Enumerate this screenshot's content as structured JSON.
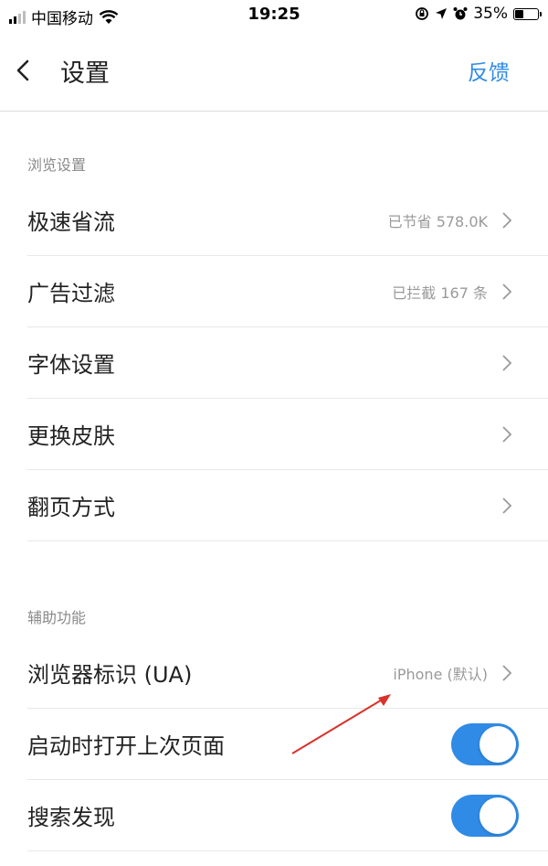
{
  "status_bar": {
    "carrier": "中国移动",
    "time": "19:25",
    "battery": "35%",
    "battery_level": 0.35
  },
  "nav": {
    "title": "设置",
    "action": "反馈"
  },
  "sections": {
    "browse": {
      "title": "浏览设置",
      "items": [
        {
          "label": "极速省流",
          "value": "已节省 578.0K"
        },
        {
          "label": "广告过滤",
          "value": "已拦截 167 条"
        },
        {
          "label": "字体设置",
          "value": ""
        },
        {
          "label": "更换皮肤",
          "value": ""
        },
        {
          "label": "翻页方式",
          "value": ""
        }
      ]
    },
    "assist": {
      "title": "辅助功能",
      "items": [
        {
          "label": "浏览器标识 (UA)",
          "value": "iPhone (默认)"
        },
        {
          "label": "启动时打开上次页面",
          "toggle_on": true
        },
        {
          "label": "搜索发现",
          "toggle_on": true
        }
      ]
    }
  },
  "colors": {
    "accent": "#2f8be6",
    "annotation_arrow": "#d9322a"
  }
}
